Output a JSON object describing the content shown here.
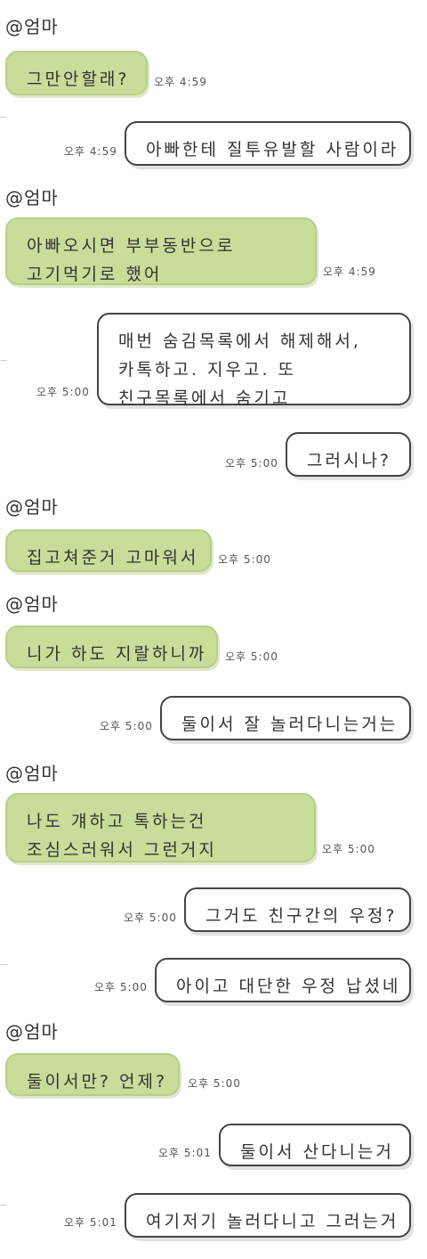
{
  "messages": [
    {
      "dir": "in",
      "sender": "@엄마",
      "lines": [
        "그만안할래?"
      ],
      "time": "오후 4:59"
    },
    {
      "dir": "out",
      "lines": [
        "아빠한테 질투유발할 사람이라"
      ],
      "time": "오후 4:59"
    },
    {
      "dir": "in",
      "sender": "@엄마",
      "lines": [
        "아빠오시면 부부동반으로",
        "고기먹기로 했어"
      ],
      "time": "오후 4:59"
    },
    {
      "dir": "out",
      "lines": [
        "매번 숨김목록에서 해제해서,",
        "카톡하고. 지우고. 또",
        "친구목록에서 숨기고"
      ],
      "time": "오후 5:00"
    },
    {
      "dir": "out",
      "lines": [
        "그러시나?"
      ],
      "time": "오후 5:00"
    },
    {
      "dir": "in",
      "sender": "@엄마",
      "lines": [
        "집고쳐준거 고마워서"
      ],
      "time": "오후 5:00"
    },
    {
      "dir": "in",
      "sender": "@엄마",
      "lines": [
        "니가 하도 지랄하니까"
      ],
      "time": "오후 5:00"
    },
    {
      "dir": "out",
      "lines": [
        "둘이서 잘 놀러다니는거는"
      ],
      "time": "오후 5:00"
    },
    {
      "dir": "in",
      "sender": "@엄마",
      "lines": [
        "나도 걔하고 톡하는건",
        "조심스러워서 그런거지"
      ],
      "time": "오후 5:00"
    },
    {
      "dir": "out",
      "lines": [
        "그거도 친구간의 우정?"
      ],
      "time": "오후 5:00"
    },
    {
      "dir": "out",
      "lines": [
        "아이고 대단한 우정 납셨네"
      ],
      "time": "오후 5:00"
    },
    {
      "dir": "in",
      "sender": "@엄마",
      "lines": [
        "둘이서만? 언제?"
      ],
      "time": "오후 5:00"
    },
    {
      "dir": "out",
      "lines": [
        "둘이서 산다니는거"
      ],
      "time": "오후 5:01"
    },
    {
      "dir": "out",
      "lines": [
        "여기저기 놀러다니고 그러는거"
      ],
      "time": "오후 5:01"
    }
  ]
}
